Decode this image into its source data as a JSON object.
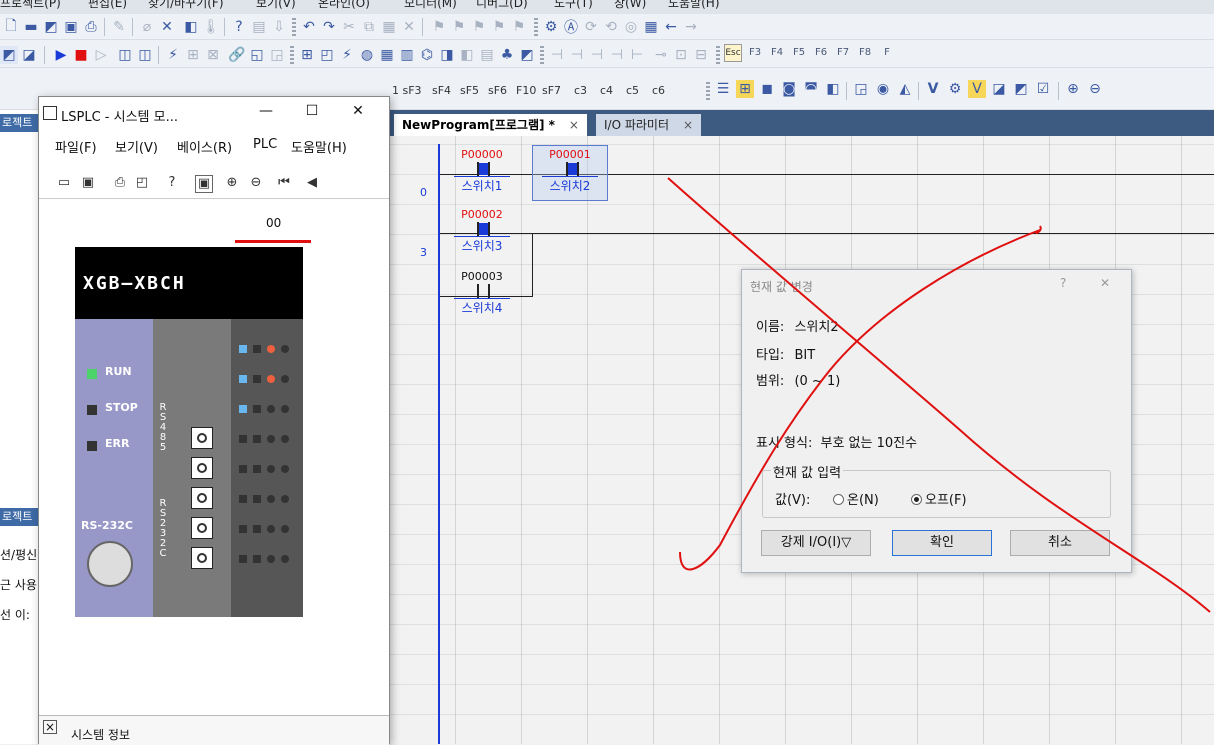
{
  "menubar": {
    "items": [
      "프로젝트(P)",
      "편집(E)",
      "찾기/바꾸기(F)",
      "보기(V)",
      "온라인(O)",
      "모니터(M)",
      "디버그(D)",
      "도구(T)",
      "창(W)",
      "도움말(H)"
    ]
  },
  "shortcut_keys": {
    "fkeys": [
      "Esc",
      "F3",
      "F4",
      "F5",
      "F6",
      "F7",
      "F8",
      "F"
    ],
    "row3": [
      "1 sF3",
      "sF4",
      "sF5",
      "sF6",
      "F10",
      "sF7",
      "c3",
      "c4",
      "c5",
      "c6"
    ]
  },
  "left_panel": {
    "header1": "로젝트",
    "header2": "로젝트",
    "item1": "션/평신",
    "item2": "근 사용",
    "item3": "선 이:"
  },
  "tabs": [
    {
      "label": "NewProgram[프로그램] *",
      "close": "×"
    },
    {
      "label": "I/O 파라미터",
      "close": "×"
    }
  ],
  "ladder": {
    "rows": [
      "0",
      "3"
    ],
    "contacts": [
      {
        "address": "P00000",
        "name": "스위치1",
        "addr_color": "red",
        "on": true
      },
      {
        "address": "P00001",
        "name": "스위치2",
        "addr_color": "red",
        "on": true,
        "selected": true
      },
      {
        "address": "P00002",
        "name": "스위치3",
        "addr_color": "red",
        "on": true
      },
      {
        "address": "P00003",
        "name": "스위치4",
        "addr_color": "black",
        "on": false
      }
    ]
  },
  "simulator": {
    "title": "LSPLC - 시스템 모...",
    "window_buttons": {
      "min": "—",
      "max": "☐",
      "close": "✕"
    },
    "menu": [
      "파일(F)",
      "보기(V)",
      "베이스(R)",
      "PLC",
      "도움말(H)"
    ],
    "status_value": "00",
    "brand": "XGB—XBCH",
    "leds": {
      "run": "RUN",
      "stop": "STOP",
      "err": "ERR"
    },
    "port_rs485": "RS485",
    "port_rs232": "RS232C",
    "rs232_label": "RS-232C",
    "bottom_label": "시스템 정보",
    "bottom_close": "×"
  },
  "dialog": {
    "title": "현재 값 변경",
    "help": "?",
    "close": "✕",
    "name_label": "이름:",
    "name_value": "스위치2",
    "type_label": "타입:",
    "type_value": "BIT",
    "range_label": "범위:",
    "range_value": "(0 ~ 1)",
    "format_label": "표시 형식:",
    "format_value": "부호 없는 10진수",
    "group_label": "현재 값 입력",
    "value_label": "값(V):",
    "radio_on": "온(N)",
    "radio_off": "오프(F)",
    "selected_radio": "off",
    "btn_force": "강제 I/O(I)▽",
    "btn_ok": "확인",
    "btn_cancel": "취소"
  },
  "colors": {
    "accent_blue": "#1a3bd8",
    "address_red": "#e01010",
    "tab_bar": "#3d5a80",
    "pen_red": "#e01010"
  }
}
